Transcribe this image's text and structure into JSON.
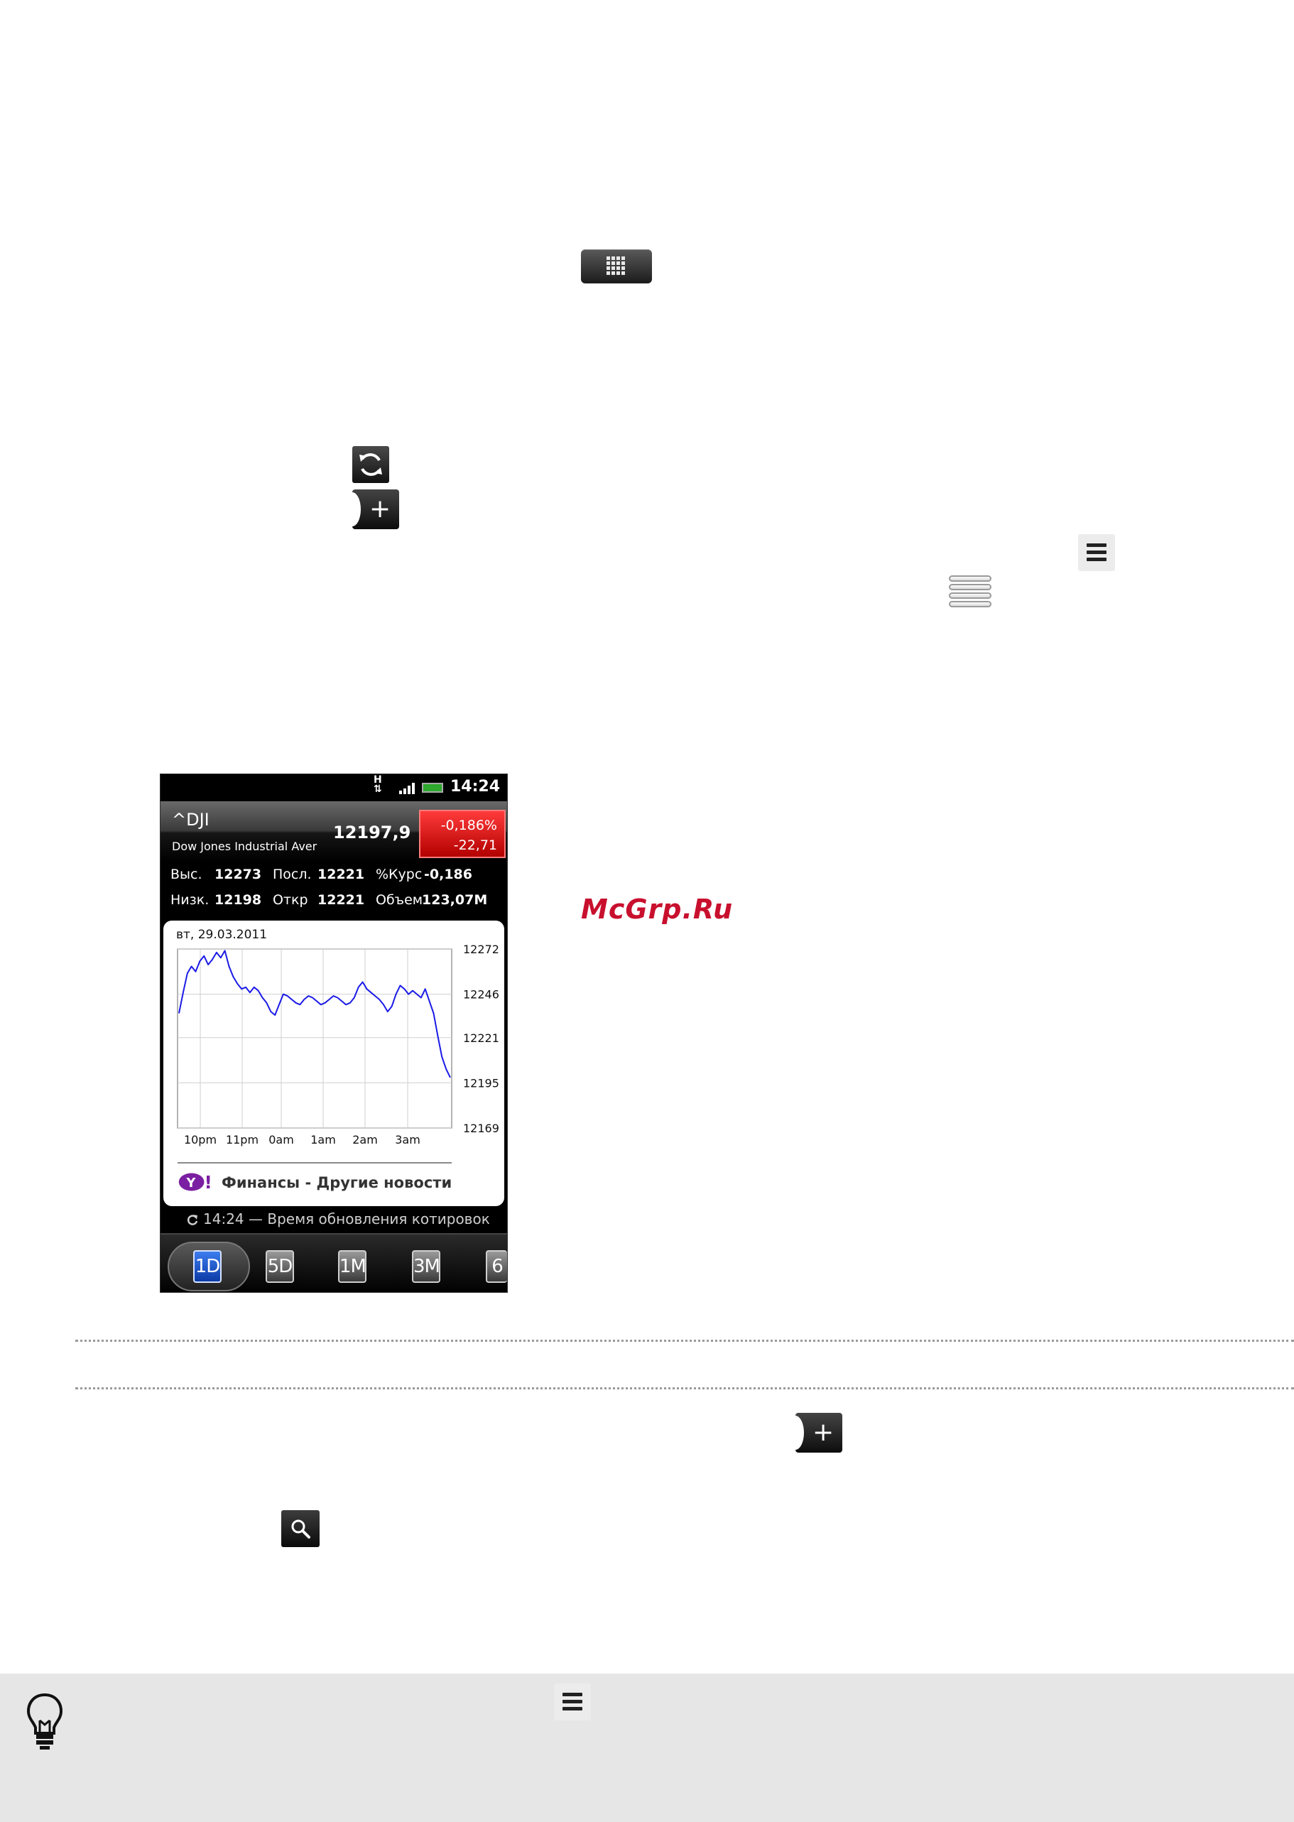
{
  "icons": {
    "apps_button": "all-apps-icon",
    "refresh": "refresh-icon",
    "add_stock": "add-icon",
    "menu": "menu-icon",
    "stack_menu": "layers-menu-icon",
    "search": "search-icon",
    "tip": "lightbulb-icon"
  },
  "watermark": "McGrp.Ru",
  "phone": {
    "status": {
      "network": "H",
      "time": "14:24"
    },
    "header": {
      "symbol": "^DJI",
      "name": "Dow Jones Industrial Aver",
      "price": "12197,9",
      "change_pct": "-0,186%",
      "change_abs": "-22,71"
    },
    "stats": [
      {
        "label": "Выс.",
        "value": "12273"
      },
      {
        "label": "Посл.",
        "value": "12221"
      },
      {
        "label": "%Курс",
        "value": "-0,186"
      },
      {
        "label": "Низк.",
        "value": "12198"
      },
      {
        "label": "Откр",
        "value": "12221"
      },
      {
        "label": "Объем",
        "value": "123,07M"
      }
    ],
    "chart_date": "вт, 29.03.2011",
    "provider_text": "Финансы - Другие новости",
    "update_time": "14:24",
    "update_label": "Время обновления котировок",
    "tabs": [
      "1D",
      "5D",
      "1M",
      "3M",
      "6"
    ],
    "selected_tab": "1D"
  },
  "chart_data": {
    "type": "line",
    "title": "",
    "xlabel": "",
    "ylabel": "",
    "x_ticks": [
      "10pm",
      "11pm",
      "0am",
      "1am",
      "2am",
      "3am"
    ],
    "y_ticks": [
      "12272",
      "12246",
      "12221",
      "12195",
      "12169"
    ],
    "ylim": [
      12169,
      12272
    ],
    "grid": true,
    "color": "#1a1ae6",
    "series": [
      {
        "values": [
          12235,
          12247,
          12258,
          12262,
          12259,
          12265,
          12268,
          12263,
          12266,
          12270,
          12267,
          12271,
          12262,
          12256,
          12252,
          12249,
          12250,
          12247,
          12250,
          12248,
          12244,
          12241,
          12236,
          12234,
          12240,
          12246,
          12245,
          12243,
          12241,
          12240,
          12243,
          12245,
          12244,
          12242,
          12240,
          12241,
          12243,
          12245,
          12244,
          12242,
          12240,
          12241,
          12244,
          12250,
          12253,
          12249,
          12247,
          12245,
          12243,
          12240,
          12236,
          12239,
          12246,
          12251,
          12249,
          12246,
          12248,
          12246,
          12244,
          12249,
          12242,
          12235,
          12222,
          12210,
          12203,
          12198
        ]
      }
    ]
  }
}
